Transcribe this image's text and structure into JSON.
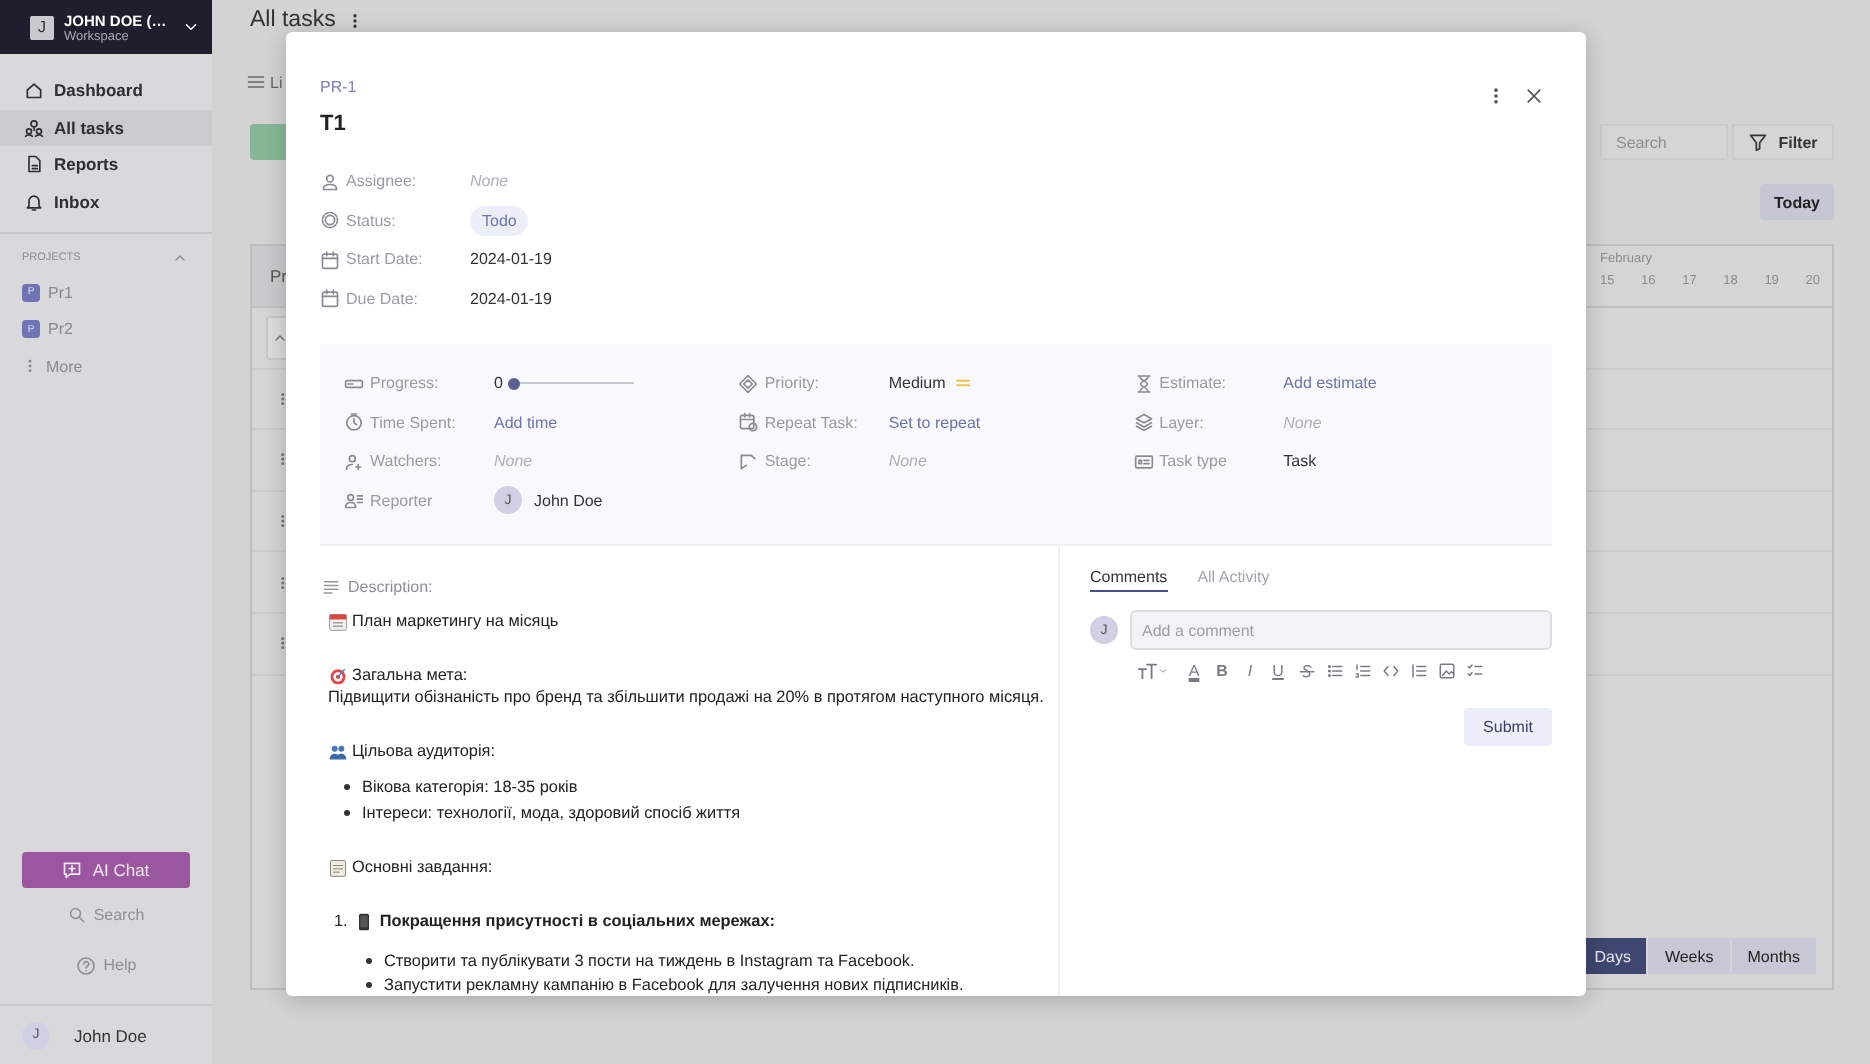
{
  "sidebar": {
    "workspace": {
      "avatar": "J",
      "name": "JOHN DOE (…",
      "subtitle": "Workspace"
    },
    "nav": [
      {
        "label": "Dashboard",
        "selected": false
      },
      {
        "label": "All tasks",
        "selected": true
      },
      {
        "label": "Reports",
        "selected": false
      },
      {
        "label": "Inbox",
        "selected": false
      }
    ],
    "projects": {
      "heading": "PROJECTS",
      "expanded": true,
      "items": [
        {
          "badge": "P",
          "label": "Pr1"
        },
        {
          "badge": "P",
          "label": "Pr2"
        }
      ],
      "more": "More"
    },
    "ai_chat": "AI Chat",
    "search": "Search",
    "help": "Help",
    "user": {
      "avatar": "J",
      "name": "John Doe"
    }
  },
  "main": {
    "title": "All tasks",
    "view_tab": "Li",
    "search": {
      "placeholder": "Search"
    },
    "filter": "Filter",
    "today": "Today",
    "gantt": {
      "column_1": "Pr",
      "month": "February",
      "days": [
        "15",
        "16",
        "17",
        "18",
        "19",
        "20"
      ]
    },
    "scales": [
      {
        "label": "Days",
        "selected": true
      },
      {
        "label": "Weeks",
        "selected": false
      },
      {
        "label": "Months",
        "selected": false
      }
    ]
  },
  "task": {
    "key": "PR-1",
    "title": "T1",
    "fields": [
      {
        "label": "Assignee:",
        "value": "None",
        "kind": "empty"
      },
      {
        "label": "Status:",
        "value": "Todo",
        "kind": "chip"
      },
      {
        "label": "Start Date:",
        "value": "2024-01-19",
        "kind": "text"
      },
      {
        "label": "Due Date:",
        "value": "2024-01-19",
        "kind": "text"
      }
    ],
    "details": [
      [
        {
          "label": "Progress:",
          "value": "0",
          "kind": "progress",
          "level": 0
        },
        {
          "label": "Time Spent:",
          "value": "Add time",
          "kind": "link"
        },
        {
          "label": "Watchers:",
          "value": "None",
          "kind": "empty"
        },
        {
          "label": "Reporter",
          "value": "John Doe",
          "avatar": "J",
          "kind": "user"
        }
      ],
      [
        {
          "label": "Priority:",
          "value": "Medium",
          "kind": "priority"
        },
        {
          "label": "Repeat Task:",
          "value": "Set to repeat",
          "kind": "link"
        },
        {
          "label": "Stage:",
          "value": "None",
          "kind": "empty"
        }
      ],
      [
        {
          "label": "Estimate:",
          "value": "Add estimate",
          "kind": "link"
        },
        {
          "label": "Layer:",
          "value": "None",
          "kind": "empty"
        },
        {
          "label": "Task type",
          "value": "Task",
          "kind": "text"
        }
      ]
    ],
    "description": {
      "label": "Description:",
      "blocks": [
        {
          "kind": "heading",
          "text": "План маркетингу на місяць"
        },
        {
          "kind": "heading",
          "text": "Загальна мета:",
          "body": "Підвищити обізнаність про бренд та збільшити продажі на 20% в протягом наступного місяця."
        },
        {
          "kind": "heading",
          "text": "Цільова аудиторія:",
          "bullets": [
            "Вікова категорія: 18-35 років",
            "Інтереси: технології, мода, здоровий спосіб життя"
          ]
        },
        {
          "kind": "heading",
          "text": "Основні завдання:"
        },
        {
          "kind": "numbered",
          "number": "1.",
          "text": "Покращення присутності в соціальних мережах:",
          "bullets": [
            "Створити та публікувати 3 пости на тиждень в Instagram та Facebook.",
            "Запустити рекламну кампанію в Facebook для залучення нових підписників."
          ]
        }
      ]
    },
    "comments": {
      "tabs": [
        {
          "label": "Comments",
          "selected": true
        },
        {
          "label": "All Activity",
          "selected": false
        }
      ],
      "avatar": "J",
      "placeholder": "Add a comment",
      "toolbar": [
        {
          "kind": "size"
        },
        {
          "kind": "color",
          "label": "A"
        },
        {
          "kind": "bold",
          "label": "B"
        },
        {
          "kind": "italic",
          "label": "I"
        },
        {
          "kind": "underline",
          "label": "U"
        },
        {
          "kind": "strike"
        },
        {
          "kind": "bullets"
        },
        {
          "kind": "numbers"
        },
        {
          "kind": "code"
        },
        {
          "kind": "quote"
        },
        {
          "kind": "image"
        },
        {
          "kind": "checklist"
        }
      ],
      "submit": "Submit"
    }
  }
}
